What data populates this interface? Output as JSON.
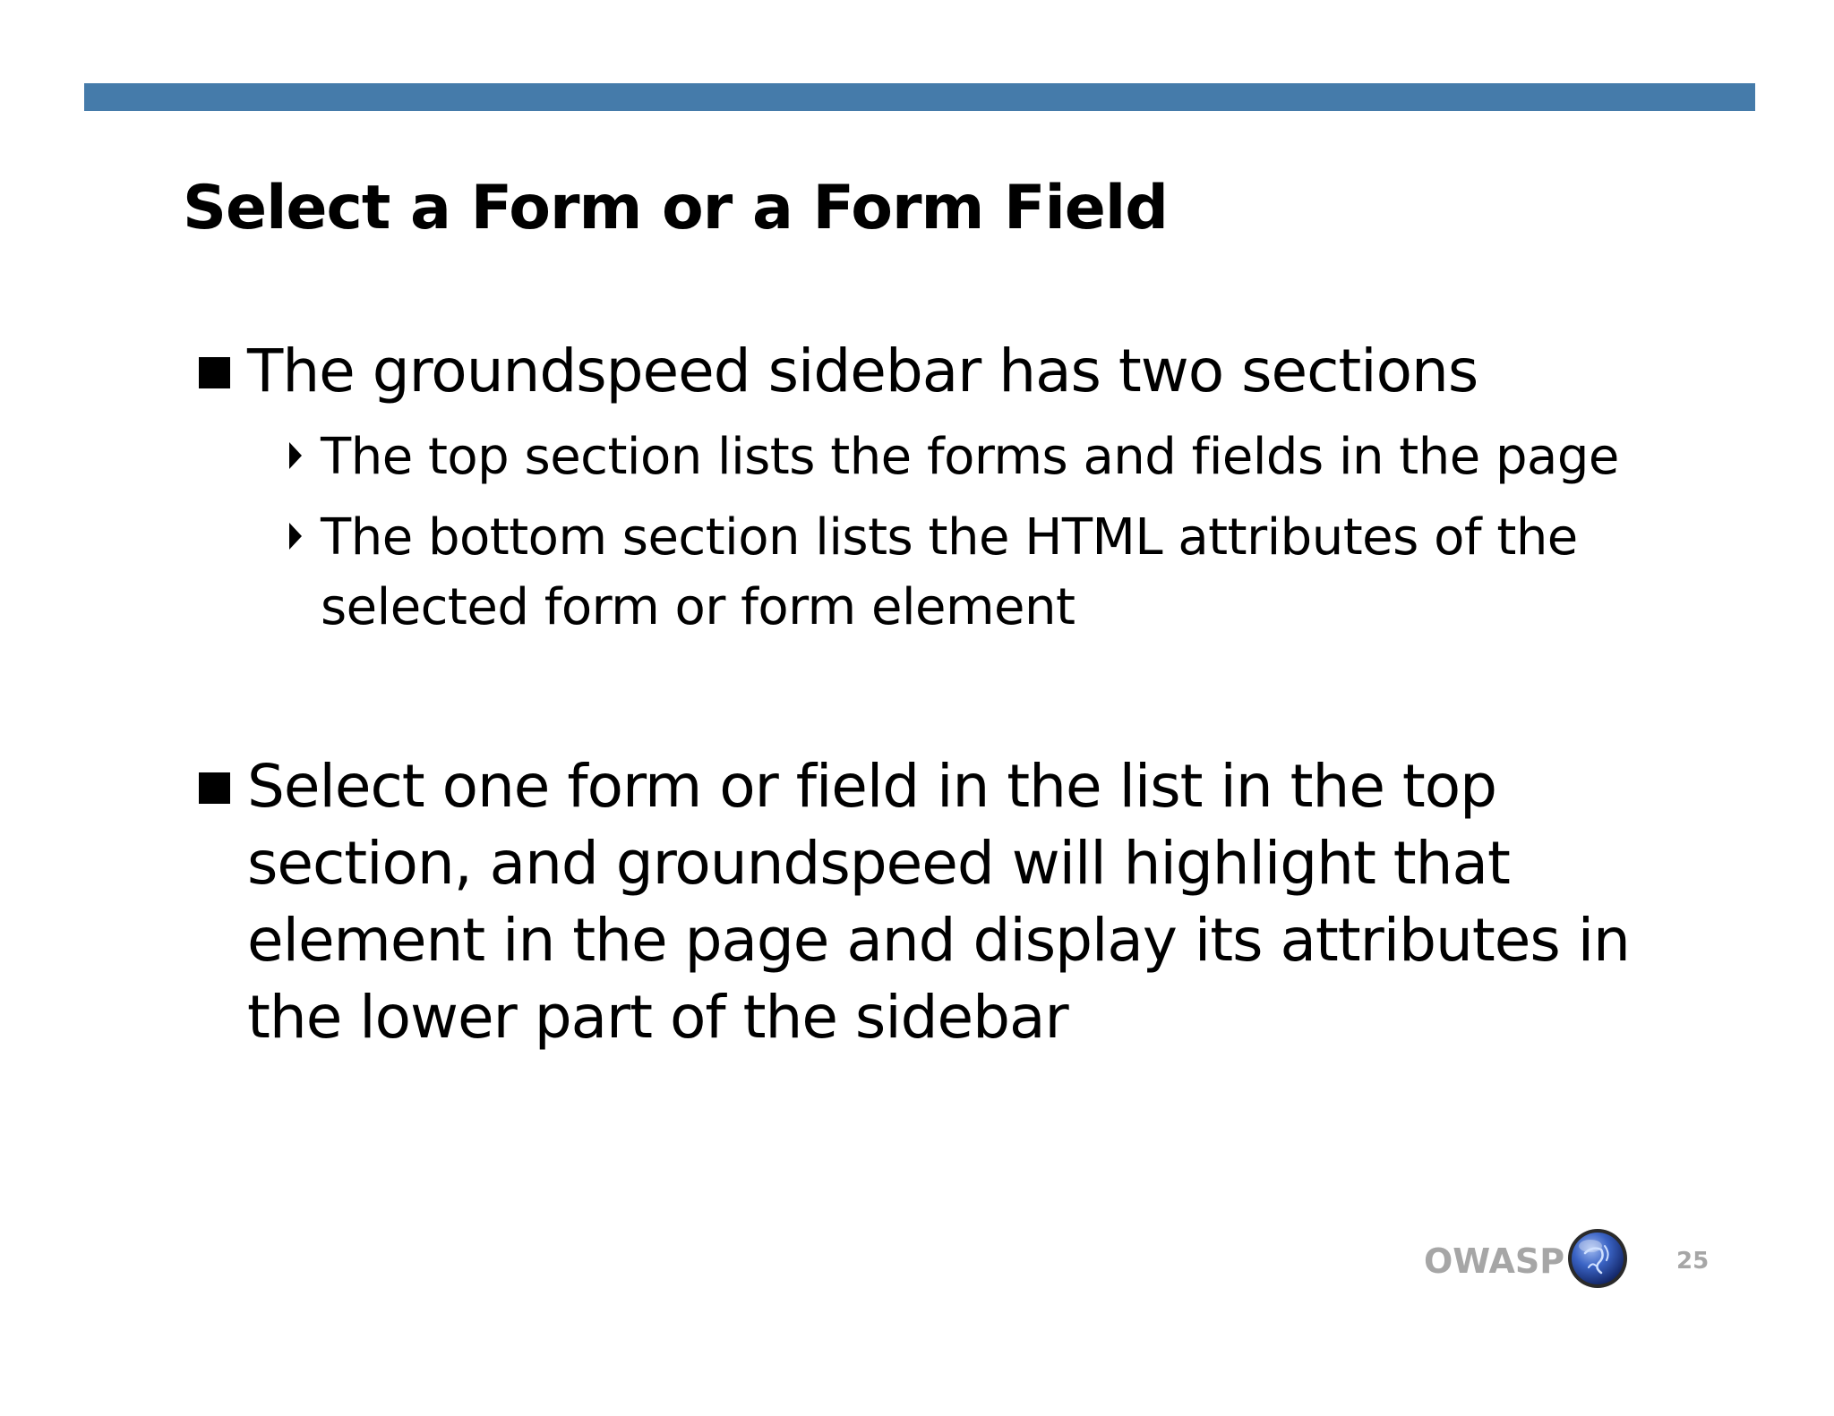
{
  "colors": {
    "bar": "#457BAA",
    "text": "#000000",
    "footer_text": "#A6A6A6",
    "logo_base": "#1E3C8C"
  },
  "slide": {
    "title": "Select a Form or a Form Field",
    "bullets": [
      {
        "text": "The groundspeed sidebar has two sections",
        "sub_bullets": [
          "The top section lists the forms and fields in the page",
          "The bottom section lists the HTML attributes of the selected form or form element"
        ]
      },
      {
        "text": "Select one form or field in the list in the top section, and groundspeed will highlight that element in the page and display its attributes in the lower part of the sidebar"
      }
    ]
  },
  "footer": {
    "brand": "OWASP",
    "logo_icon": "owasp-globe-icon",
    "page_number": "25"
  }
}
